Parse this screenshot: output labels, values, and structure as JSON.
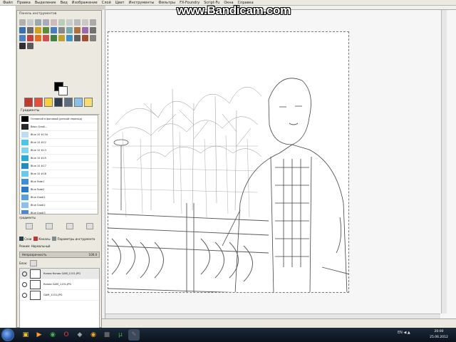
{
  "menubar": {
    "items": [
      "Файл",
      "Правка",
      "Выделение",
      "Вид",
      "Изображение",
      "Слой",
      "Цвет",
      "Инструменты",
      "Фильтры",
      "FX-Foundry",
      "Script-Fu",
      "Окна",
      "Справка"
    ]
  },
  "watermark": "www.Bandicam.com",
  "toolbox": {
    "title": "Панель инструментов",
    "colors": {
      "foreground": "#000000",
      "background": "#ffffff"
    }
  },
  "gradients": {
    "tab_label": "Градиенты",
    "items": [
      {
        "name": "Основной в фоновый (резкий переход)",
        "color": "#000000"
      },
      {
        "name": "Basic Gradi...",
        "color": "#2a2a2a"
      },
      {
        "name": "Blue 10 #134",
        "color": "#b8ddf5"
      },
      {
        "name": "Blue 10 #12",
        "color": "#4fc3e8"
      },
      {
        "name": "Blue 10 #13",
        "color": "#7fd5ee"
      },
      {
        "name": "Blue 10 #15",
        "color": "#2aa8d8"
      },
      {
        "name": "Blue 10 #17",
        "color": "#1e8cc8"
      },
      {
        "name": "Blue 10 #18",
        "color": "#6bc8ea"
      },
      {
        "name": "Blue Fade1",
        "color": "#3e8ed8"
      },
      {
        "name": "Blue Fade2",
        "color": "#2d78c8"
      },
      {
        "name": "Blue Gradi1",
        "color": "#5aa0dc"
      },
      {
        "name": "Blue Gradi2",
        "color": "#8ebfe8"
      },
      {
        "name": "Blue Gradi3",
        "color": "#4a88d0"
      }
    ],
    "footer": "градиенты"
  },
  "layers": {
    "tabs": [
      "Слои",
      "Каналы",
      "Параметры инструмента"
    ],
    "mode_label": "Режим: Нормальный",
    "opacity_label": "Непрозрачность",
    "opacity_value": "100.0",
    "lock_label": "Блок:",
    "items": [
      {
        "name": "Копия Копия GAM_1151.JPG"
      },
      {
        "name": "Копия GAM_1151.JPG"
      },
      {
        "name": "GAM_1151.JPG"
      }
    ]
  },
  "taskbar": {
    "apps": [
      {
        "name": "explorer",
        "glyph": "▣",
        "color": "#f0c040"
      },
      {
        "name": "media",
        "glyph": "▶",
        "color": "#ff9e30"
      },
      {
        "name": "chrome",
        "glyph": "◉",
        "color": "#4caf50"
      },
      {
        "name": "opera",
        "glyph": "O",
        "color": "#e53935"
      },
      {
        "name": "app5",
        "glyph": "◆",
        "color": "#9e9e9e"
      },
      {
        "name": "chrome2",
        "glyph": "◉",
        "color": "#f9a825"
      },
      {
        "name": "app7",
        "glyph": "■",
        "color": "#616161"
      },
      {
        "name": "torrent",
        "glyph": "μ",
        "color": "#43a047"
      },
      {
        "name": "gimp",
        "glyph": "✎",
        "color": "#8d6e63"
      }
    ],
    "tray_text": "EN ◀ ▲",
    "time": "20:00",
    "date": "25.06.2012"
  }
}
